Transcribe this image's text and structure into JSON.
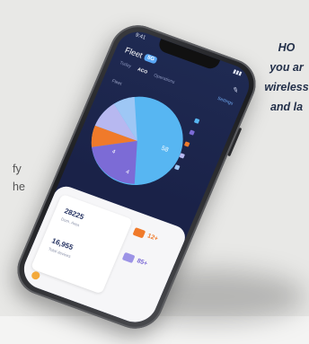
{
  "tagline": {
    "line1": "HO",
    "line2": "you ar",
    "line3": "wireless",
    "line4": "and la"
  },
  "edge_text": {
    "line1": "fy",
    "line2": "he"
  },
  "app": {
    "title": "Fleet",
    "badge": "5G",
    "tabs": [
      "Today",
      "ACO",
      "Operations"
    ],
    "tab_right": "Settings",
    "section_label": "Fleet",
    "pie_labels": [
      "58",
      "4",
      "4"
    ]
  },
  "colors": {
    "slice_blue": "#57b6f2",
    "slice_purple": "#7c6bd6",
    "slice_orange": "#f07a2a",
    "slice_lilac": "#b7b8f0",
    "slice_light": "#9ec7f5"
  },
  "stats": {
    "value1": "28225",
    "sub1": "Dom. Area",
    "value2": "16,955",
    "sub2": "Total devices"
  },
  "pills": {
    "p1": "12+",
    "p2": "85+"
  }
}
